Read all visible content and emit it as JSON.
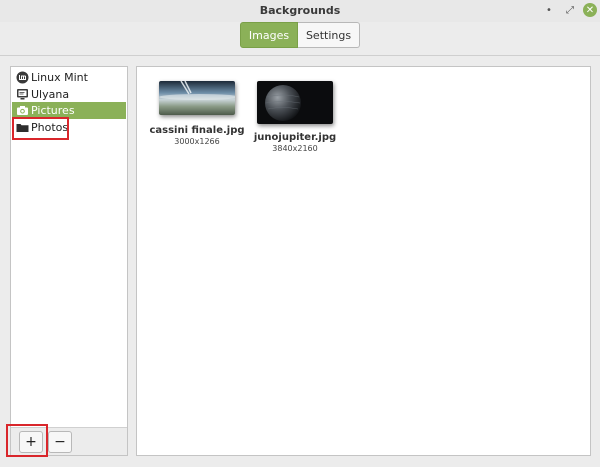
{
  "window": {
    "title": "Backgrounds",
    "controls": {
      "minimize": "•",
      "maximize": "⤢",
      "close": "✕"
    }
  },
  "tabs": [
    {
      "label": "Images",
      "active": true
    },
    {
      "label": "Settings",
      "active": false
    }
  ],
  "sidebar": {
    "items": [
      {
        "label": "Linux Mint",
        "icon": "linux-mint-icon",
        "selected": false
      },
      {
        "label": "Ulyana",
        "icon": "monitor-icon",
        "selected": false
      },
      {
        "label": "Pictures",
        "icon": "camera-icon",
        "selected": true
      },
      {
        "label": "Photos",
        "icon": "folder-icon",
        "selected": false
      }
    ],
    "add_label": "+",
    "remove_label": "−"
  },
  "images": [
    {
      "name": "cassini finale.jpg",
      "dimensions": "3000x1266"
    },
    {
      "name": "junojupiter.jpg",
      "dimensions": "3840x2160"
    }
  ],
  "colors": {
    "accent": "#8bb158",
    "highlight": "#d9262b"
  }
}
